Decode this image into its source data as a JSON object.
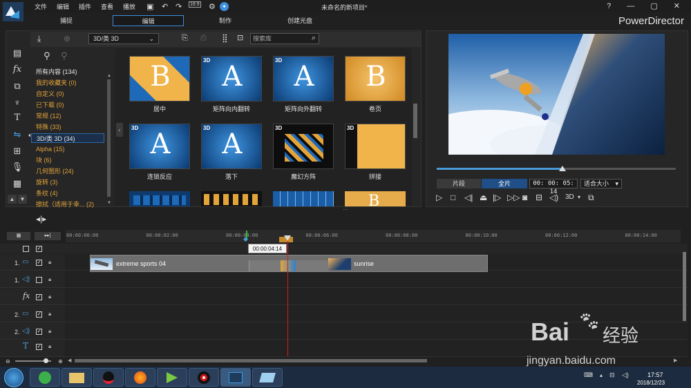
{
  "menu": [
    "文件",
    "编辑",
    "插件",
    "查看",
    "播放"
  ],
  "window_title": "未命名的新项目*",
  "top_right_icons": "? — ▢ ✕",
  "zoom_label": "16:9",
  "mode_tabs": [
    "捕捉",
    "编辑",
    "制作",
    "创建光盘"
  ],
  "brand": "PowerDirector",
  "library": {
    "dropdown": "3D/类 3D",
    "search_placeholder": "搜索库",
    "categories": [
      {
        "label": "所有内容 (134)",
        "style": "white"
      },
      {
        "label": "我的收藏夹 (0)",
        "style": "orange"
      },
      {
        "label": "自定义 (0)",
        "style": "orange"
      },
      {
        "label": "已下载 (0)",
        "style": "orange"
      },
      {
        "label": "常规 (12)",
        "style": "orange"
      },
      {
        "label": "特殊 (33)",
        "style": "orange"
      },
      {
        "label": "3D/类 3D (34)",
        "style": "selected"
      },
      {
        "label": "Alpha (15)",
        "style": "orange"
      },
      {
        "label": "块 (6)",
        "style": "orange"
      },
      {
        "label": "几何图形 (24)",
        "style": "orange"
      },
      {
        "label": "旋转 (3)",
        "style": "orange"
      },
      {
        "label": "条纹 (4)",
        "style": "orange"
      },
      {
        "label": "擦拭（适用于幸... (2)",
        "style": "orange"
      }
    ],
    "thumbnails": [
      {
        "label": "居中",
        "letter": "B",
        "badge": ""
      },
      {
        "label": "矩阵向内翻转",
        "letter": "A",
        "badge": "3D"
      },
      {
        "label": "矩阵向外翻转",
        "letter": "A",
        "badge": "3D"
      },
      {
        "label": "卷页",
        "letter": "B",
        "badge": ""
      },
      {
        "label": "连锁反应",
        "letter": "A",
        "badge": "3D"
      },
      {
        "label": "落下",
        "letter": "A",
        "badge": "3D"
      },
      {
        "label": "魔幻方阵",
        "letter": "",
        "badge": "3D"
      },
      {
        "label": "拼接",
        "letter": "",
        "badge": "3D"
      }
    ]
  },
  "preview": {
    "seg_label": "片段",
    "full_label": "全片",
    "timecode": "00: 00: 05: 14",
    "fit_label": "适合大小",
    "three_d": "3D",
    "seek_fraction": 0.527
  },
  "timeline": {
    "ticks": [
      "00:00:00:00",
      "00:00:02:00",
      "00:00:04:00",
      "00:00:06:00",
      "00:00:08:00",
      "00:00:10:00",
      "00:00:12:00",
      "00:00:14:00"
    ],
    "tooltip": "00:00:04:14",
    "clip1": "extreme sports 04",
    "clip2": "sunrise",
    "track_labels": [
      "1.",
      "1.",
      "fx",
      "2.",
      "2.",
      "T"
    ]
  },
  "clock": {
    "time": "17:57",
    "date": "2018/12/23"
  },
  "watermark": {
    "line1": "Bai",
    "line2": "经验",
    "url": "jingyan.baidu.com"
  }
}
